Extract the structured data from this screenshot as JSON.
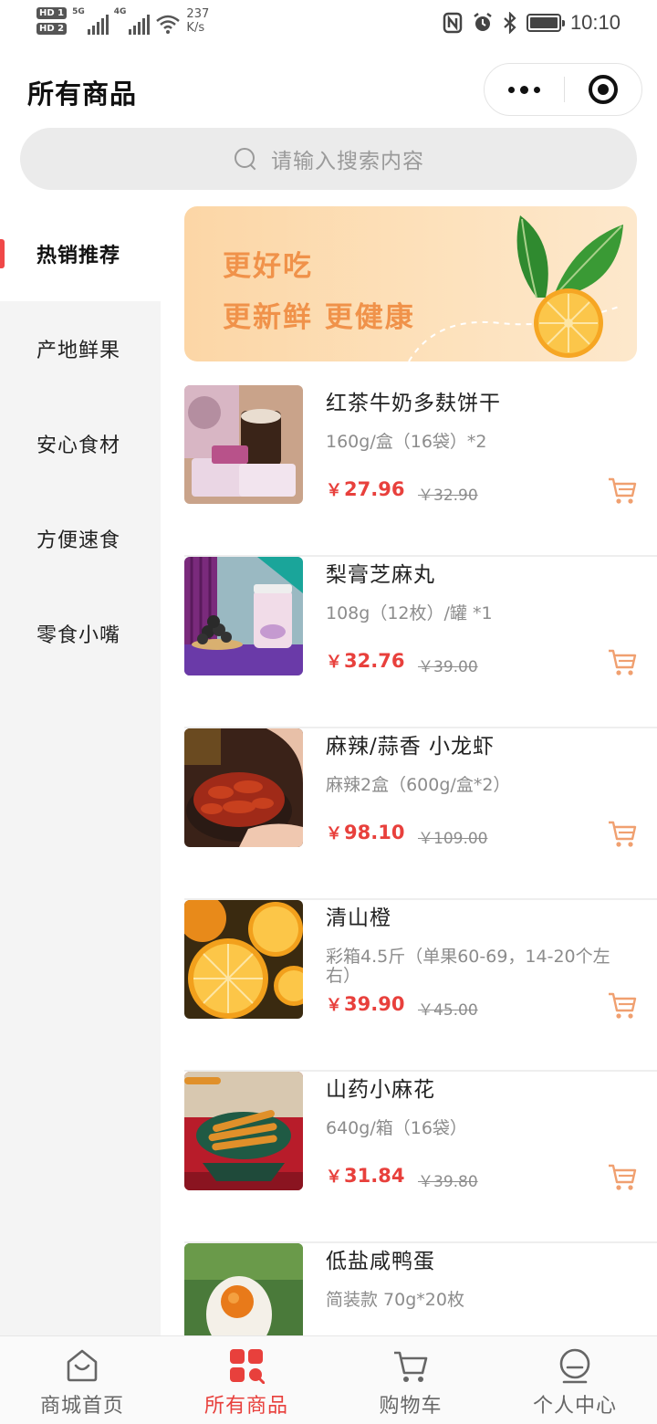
{
  "status_bar": {
    "hd1": "HD 1",
    "hd2": "HD 2",
    "net1": "5G",
    "net2": "4G",
    "speed_value": "237",
    "speed_unit": "K/s",
    "time": "10:10"
  },
  "header": {
    "title": "所有商品"
  },
  "search": {
    "placeholder": "请输入搜索内容"
  },
  "sidebar": {
    "items": [
      {
        "label": "热销推荐",
        "active": true
      },
      {
        "label": "产地鲜果",
        "active": false
      },
      {
        "label": "安心食材",
        "active": false
      },
      {
        "label": "方便速食",
        "active": false
      },
      {
        "label": "零食小嘴",
        "active": false
      }
    ]
  },
  "banner": {
    "line1": "更好吃",
    "line2": "更新鲜 更健康"
  },
  "currency": "￥",
  "products": [
    {
      "name": "红茶牛奶多麸饼干",
      "spec": "160g/盒（16袋）*2",
      "price": "27.96",
      "old_price": "￥32.90"
    },
    {
      "name": "梨膏芝麻丸",
      "spec": "108g（12枚）/罐 *1",
      "price": "32.76",
      "old_price": "￥39.00"
    },
    {
      "name": "麻辣/蒜香 小龙虾",
      "spec": "麻辣2盒（600g/盒*2）",
      "price": "98.10",
      "old_price": "￥109.00"
    },
    {
      "name": "清山橙",
      "spec": "彩箱4.5斤（单果60-69，14-20个左右）",
      "price": "39.90",
      "old_price": "￥45.00"
    },
    {
      "name": "山药小麻花",
      "spec": "640g/箱（16袋）",
      "price": "31.84",
      "old_price": "￥39.80"
    },
    {
      "name": "低盐咸鸭蛋",
      "spec": "简装款 70g*20枚",
      "price": "",
      "old_price": ""
    }
  ],
  "tabbar": {
    "items": [
      {
        "label": "商城首页",
        "icon": "home-bag-icon",
        "active": false
      },
      {
        "label": "所有商品",
        "icon": "grid-icon",
        "active": true
      },
      {
        "label": "购物车",
        "icon": "cart-icon",
        "active": false
      },
      {
        "label": "个人中心",
        "icon": "user-icon",
        "active": false
      }
    ]
  },
  "colors": {
    "accent": "#e8403c",
    "banner_text": "#f0924a",
    "cart_icon": "#f0a070"
  }
}
